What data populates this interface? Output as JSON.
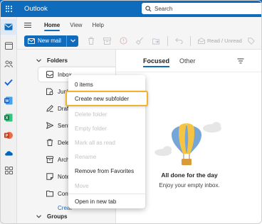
{
  "app": {
    "title": "Outlook"
  },
  "search": {
    "placeholder": "Search"
  },
  "ribbon": {
    "tabs": [
      {
        "label": "Home",
        "active": true
      },
      {
        "label": "View",
        "active": false
      },
      {
        "label": "Help",
        "active": false
      }
    ],
    "new_mail_label": "New mail",
    "read_unread_label": "Read / Unread"
  },
  "folders": {
    "header": "Folders",
    "items": [
      {
        "label": "Inbox",
        "icon": "inbox-icon"
      },
      {
        "label": "Junk",
        "icon": "junk-icon"
      },
      {
        "label": "Drafts",
        "icon": "drafts-icon"
      },
      {
        "label": "Sent",
        "icon": "sent-icon"
      },
      {
        "label": "Delete",
        "icon": "deleted-icon"
      },
      {
        "label": "Archiv",
        "icon": "archive-icon"
      },
      {
        "label": "Notes",
        "icon": "notes-icon"
      },
      {
        "label": "Conve",
        "icon": "conversation-icon"
      }
    ],
    "create_label": "Creat",
    "groups_header": "Groups"
  },
  "message_list": {
    "tabs": [
      {
        "label": "Focused",
        "active": true
      },
      {
        "label": "Other",
        "active": false
      }
    ],
    "empty_title": "All done for the day",
    "empty_subtitle": "Enjoy your empty inbox."
  },
  "context_menu": {
    "items": [
      {
        "label": "0 items",
        "disabled": false
      },
      {
        "label": "Create new subfolder",
        "disabled": false,
        "highlight": true
      },
      {
        "label": "Delete folder",
        "disabled": true
      },
      {
        "label": "Empty folder",
        "disabled": true
      },
      {
        "label": "Mark all as read",
        "disabled": true
      },
      {
        "label": "Rename",
        "disabled": true
      },
      {
        "label": "Remove from Favorites",
        "disabled": false
      },
      {
        "label": "Move",
        "disabled": true
      },
      {
        "label": "Open in new tab",
        "disabled": false
      }
    ]
  },
  "colors": {
    "brand": "#0f6cbd",
    "highlight_border": "#f5b12c",
    "pane_bg": "#f5f5f5"
  }
}
